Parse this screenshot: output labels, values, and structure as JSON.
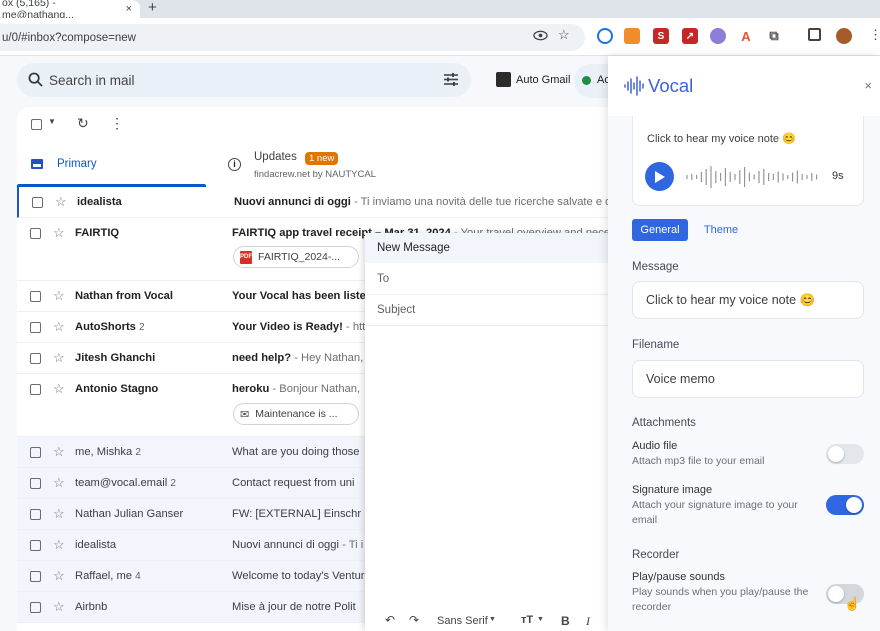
{
  "browser": {
    "tab_title": "ox (5,165) - me@nathang...",
    "tab_close": "×",
    "new_tab": "+",
    "url": "u/0/#inbox?compose=new"
  },
  "gmail": {
    "search_placeholder": "Search in mail",
    "auto_gmail_label": "Auto Gmail",
    "active_label": "Ac",
    "tabs": {
      "primary": "Primary",
      "updates": "Updates",
      "updates_badge": "1 new",
      "updates_sub": "findacrew.net by NAUTYCAL"
    },
    "rows": [
      {
        "sender": "idealista",
        "count": "",
        "subject": "Nuovi annunci di oggi",
        "snippet": " - Ti inviamo una novità delle tue ricerche salvate e d"
      },
      {
        "sender": "FAIRTIQ",
        "count": "",
        "subject": "FAIRTIQ app travel receipt – Mar 31, 2024",
        "snippet": " - Your travel overview and nece"
      },
      {
        "sender": "Nathan from Vocal",
        "count": "",
        "subject": "Your Vocal has been liste",
        "snippet": ""
      },
      {
        "sender": "AutoShorts",
        "count": "2",
        "subject": "Your Video is Ready!",
        "snippet": " - htt"
      },
      {
        "sender": "Jitesh Ghanchi",
        "count": "",
        "subject": "need help?",
        "snippet": " - Hey Nathan,"
      },
      {
        "sender": "Antonio Stagno",
        "count": "",
        "subject": "heroku",
        "snippet": " - Bonjour Nathan,"
      },
      {
        "sender": "me, Mishka",
        "count": "2",
        "subject": "What are you doing those",
        "snippet": ""
      },
      {
        "sender": "team@vocal.email",
        "count": "2",
        "subject": "Contact request from uni",
        "snippet": ""
      },
      {
        "sender": "Nathan Julian Ganser",
        "count": "",
        "subject": "FW: [EXTERNAL] Einschr",
        "snippet": ""
      },
      {
        "sender": "idealista",
        "count": "",
        "subject": "Nuovi annunci di oggi",
        "snippet": " - Ti i"
      },
      {
        "sender": "Raffael, me",
        "count": "4",
        "subject": "Welcome to today's Ventur",
        "snippet": ""
      },
      {
        "sender": "Airbnb",
        "count": "",
        "subject": "Mise à jour de notre Polit",
        "snippet": ""
      }
    ],
    "attachments": {
      "fairtiq": "FAIRTIQ_2024-...",
      "heroku": "Maintenance is ..."
    }
  },
  "compose": {
    "title": "New Message",
    "to_label": "To",
    "subject_label": "Subject",
    "font_label": "Sans Serif"
  },
  "vocal": {
    "title": "Vocal",
    "close": "×",
    "preview_text": "Click to hear my voice note 😊",
    "duration": "9s",
    "tab_general": "General",
    "tab_theme": "Theme",
    "message_label": "Message",
    "message_value": "Click to hear my voice note 😊",
    "filename_label": "Filename",
    "filename_value": "Voice memo",
    "attachments_label": "Attachments",
    "audio_title": "Audio file",
    "audio_desc": "Attach mp3 file to your email",
    "signature_title": "Signature image",
    "signature_desc": "Attach your signature image to your email",
    "recorder_label": "Recorder",
    "playpause_title": "Play/pause sounds",
    "playpause_desc": "Play sounds when you play/pause the recorder",
    "accent_color": "#2f67e0",
    "toggles": {
      "audio_file": false,
      "signature_image": true,
      "play_pause_sounds": false
    }
  }
}
